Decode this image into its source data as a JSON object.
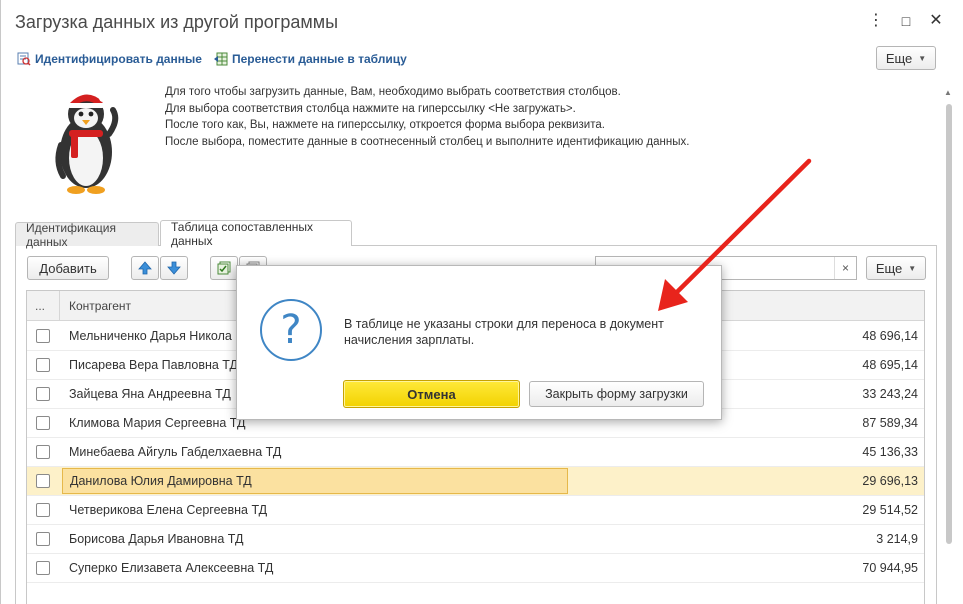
{
  "window": {
    "title": "Загрузка данных из другой программы",
    "minimize": "⋮",
    "maximize": "□",
    "close": "✕"
  },
  "commands": {
    "identify": "Идентифицировать данные",
    "transfer": "Перенести данные в таблицу",
    "more": "Еще"
  },
  "info_lines": [
    "Для того чтобы загрузить данные, Вам, необходимо выбрать соответствия столбцов.",
    "Для выбора соответствия столбца нажмите на гиперссылку <Не загружать>.",
    "После того как, Вы, нажмете на гиперссылку, откроется форма выбора реквизита.",
    "После выбора, поместите данные в соотнесенный столбец и выполните идентификацию данных."
  ],
  "tabs": [
    {
      "label": "Идентификация данных",
      "active": false
    },
    {
      "label": "Таблица сопоставленных данных",
      "active": true
    }
  ],
  "toolbar": {
    "add": "Добавить",
    "more": "Еще",
    "search_value": "",
    "clear": "×"
  },
  "grid": {
    "col_marker": "...",
    "col_counterparty": "Контрагент",
    "rows": [
      {
        "name": "Мельниченко Дарья Никола",
        "sum": "48 696,14",
        "selected": false
      },
      {
        "name": "Писарева Вера Павловна ТД",
        "sum": "48 695,14",
        "selected": false
      },
      {
        "name": "Зайцева Яна Андреевна ТД",
        "sum": "33 243,24",
        "selected": false
      },
      {
        "name": "Климова Мария Сергеевна ТД",
        "sum": "87 589,34",
        "selected": false
      },
      {
        "name": "Минебаева Айгуль Габделхаевна ТД",
        "sum": "45 136,33",
        "selected": false
      },
      {
        "name": "Данилова Юлия Дамировна ТД",
        "sum": "29 696,13",
        "selected": true
      },
      {
        "name": "Четверикова Елена Сергеевна ТД",
        "sum": "29 514,52",
        "selected": false
      },
      {
        "name": "Борисова Дарья Ивановна ТД",
        "sum": "3 214,9",
        "selected": false
      },
      {
        "name": "Суперко Елизавета Алексеевна ТД",
        "sum": "70 944,95",
        "selected": false
      }
    ]
  },
  "dialog": {
    "icon": "?",
    "message": "В таблице не указаны строки для переноса в документ начисления зарплаты.",
    "cancel": "Отмена",
    "close_form": "Закрыть форму загрузки"
  },
  "colors": {
    "accent_blue": "#2a5c96",
    "selected_row": "#fdf1c9",
    "primary_button": "#f2d200",
    "annotation_arrow": "#e8241c"
  }
}
